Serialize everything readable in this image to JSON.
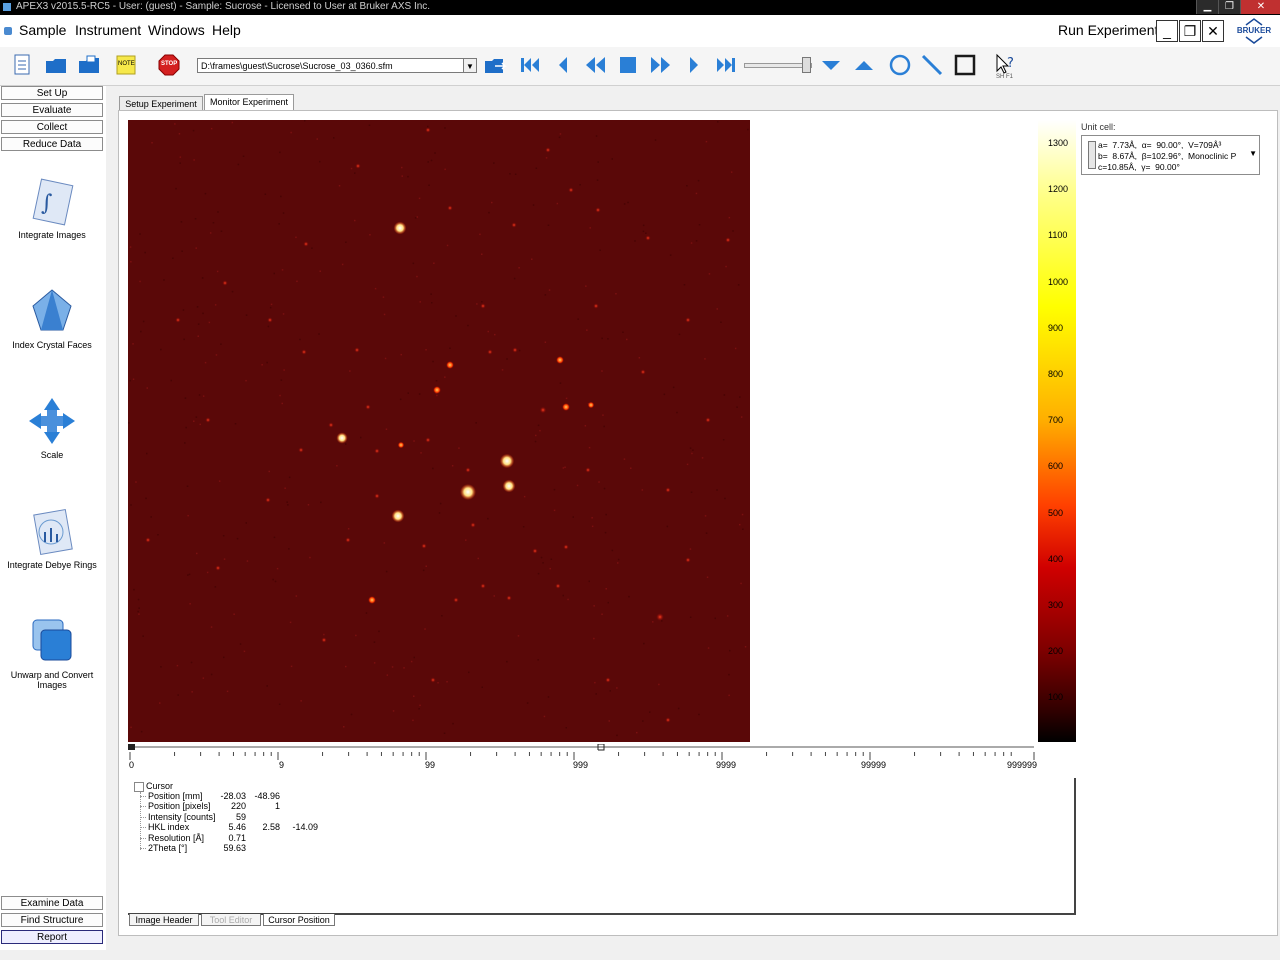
{
  "window": {
    "title": "APEX3 v2015.5-RC5 - User: (guest) - Sample: Sucrose - Licensed to User at Bruker AXS Inc."
  },
  "menu": {
    "items": [
      "Sample",
      "Instrument",
      "Windows",
      "Help"
    ],
    "run_experiment": "Run Experiment",
    "logo_text": "BRUKER"
  },
  "toolbar": {
    "note_label": "NOTE",
    "stop_label": "STOP",
    "file_path": "D:\\frames\\guest\\Sucrose\\Sucrose_03_0360.sfm",
    "help_label": "SH F1"
  },
  "sidebar": {
    "top_buttons": [
      "Set Up",
      "Evaluate",
      "Collect",
      "Reduce Data"
    ],
    "tools": [
      "Integrate Images",
      "Index Crystal Faces",
      "Scale",
      "Integrate Debye Rings",
      "Unwarp and Convert Images"
    ],
    "bottom_buttons": [
      "Examine Data",
      "Find Structure",
      "Report"
    ]
  },
  "tabs": [
    "Setup Experiment",
    "Monitor Experiment"
  ],
  "colorbar": {
    "labels": [
      "1300",
      "1200",
      "1100",
      "1000",
      "900",
      "800",
      "700",
      "600",
      "500",
      "400",
      "300",
      "200",
      "100"
    ]
  },
  "unit_cell": {
    "title": "Unit cell:",
    "line1": "a=  7.73Å,  α=  90.00°,  V=709Å³",
    "line2": "b=  8.67Å,  β=102.96°,  Monoclinic P",
    "line3": "c=10.85Å,  γ=  90.00°"
  },
  "scale": {
    "labels": [
      "0",
      "9",
      "99",
      "999",
      "9999",
      "99999",
      "999999"
    ]
  },
  "cursor": {
    "title": "Cursor",
    "rows": [
      {
        "label": "Position [mm]",
        "v1": "-28.03",
        "v2": "-48.96",
        "v3": ""
      },
      {
        "label": "Position [pixels]",
        "v1": "220",
        "v2": "1",
        "v3": ""
      },
      {
        "label": "Intensity [counts]",
        "v1": "59",
        "v2": "",
        "v3": ""
      },
      {
        "label": "HKL index",
        "v1": "5.46",
        "v2": "2.58",
        "v3": "-14.09"
      },
      {
        "label": "Resolution [Å]",
        "v1": "0.71",
        "v2": "",
        "v3": ""
      },
      {
        "label": "2Theta [°]",
        "v1": "59.63",
        "v2": "",
        "v3": ""
      }
    ]
  },
  "bottom_tabs": [
    "Image Header",
    "Tool Editor",
    "Cursor Position"
  ],
  "colors": {
    "frame_background": "#5a0808",
    "accent": "#1a6fd0"
  }
}
